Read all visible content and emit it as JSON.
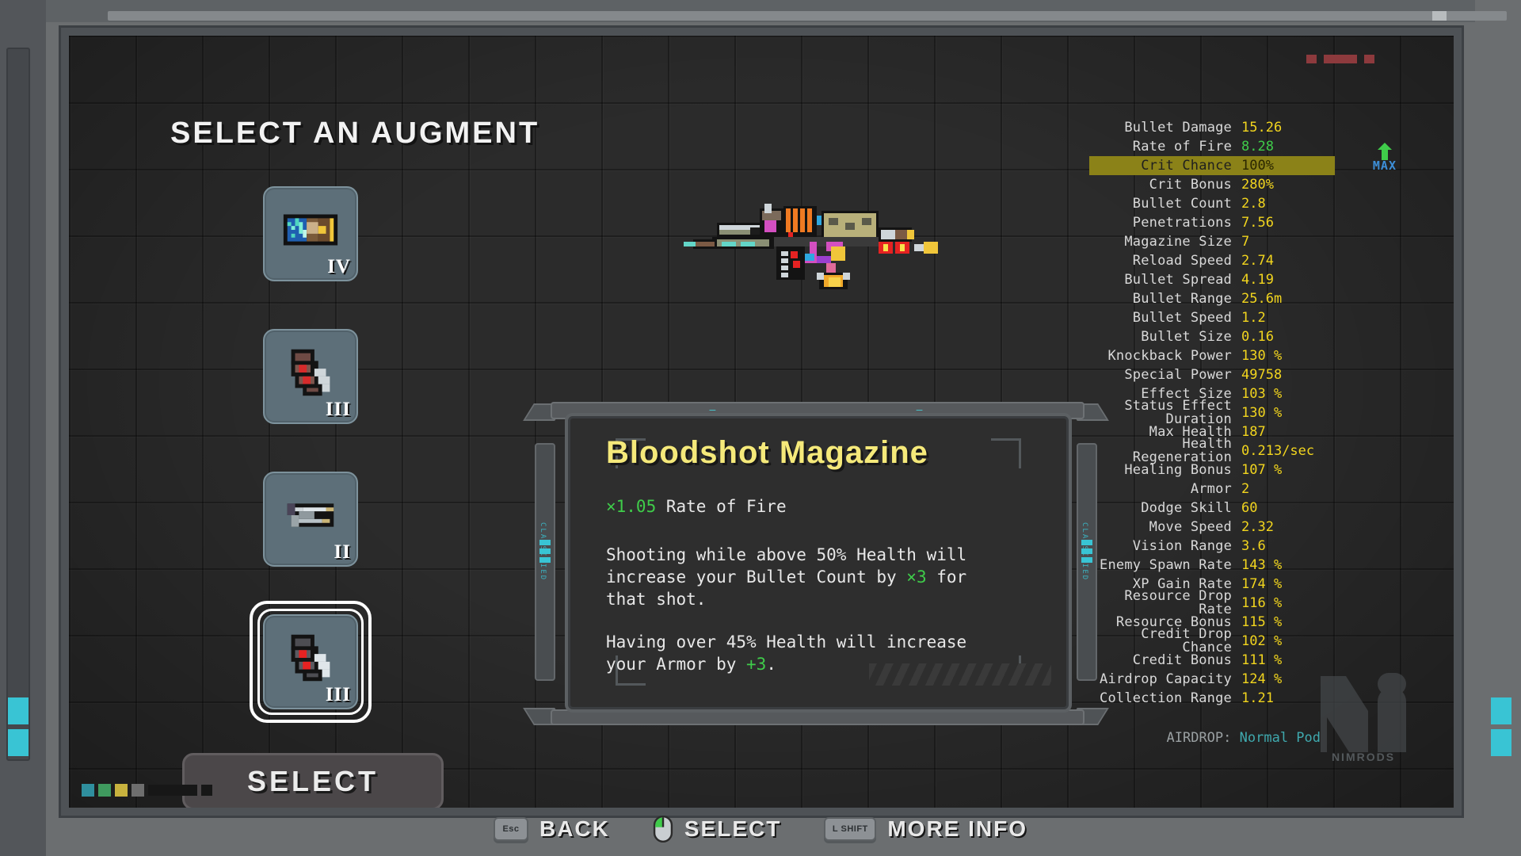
{
  "window": {
    "title_bar": ""
  },
  "heading": "SELECT AN AUGMENT",
  "select_button": {
    "label": "SELECT"
  },
  "augment_cards": [
    {
      "tier": "IV",
      "icon": "battery-magazine-icon",
      "selected": false
    },
    {
      "tier": "III",
      "icon": "bloodshot-magazine-icon",
      "selected": false
    },
    {
      "tier": "II",
      "icon": "speed-loader-icon",
      "selected": false
    },
    {
      "tier": "III",
      "icon": "bloodshot-magazine-icon",
      "selected": true
    }
  ],
  "tooltip": {
    "title": "Bloodshot Magazine",
    "stat_line": {
      "multiplier": "×1.05",
      "stat": "Rate of Fire"
    },
    "desc_1_a": "Shooting while above 50% Health will increase your Bullet Count by ",
    "desc_1_b": "×3",
    "desc_1_c": " for that shot.",
    "desc_2_a": "Having over 45% Health will increase your Armor by ",
    "desc_2_b": "+3",
    "desc_2_c": ".",
    "side_label_left": "CLASSIFIED",
    "side_label_right": "CLASSIFIED",
    "runes": "— ⑁ ⑃ ⑅ ⑂ ⑊ ⑆ ⑄ ⑇ ⑈ ⑉ ⑀ ⑋ ⑁ ⑄ ⑇ —"
  },
  "stats": {
    "rows": [
      {
        "label": "Bullet Damage",
        "value": "15.26",
        "style": "normal"
      },
      {
        "label": "Rate of Fire",
        "value": "8.28",
        "style": "green"
      },
      {
        "label": "Crit Chance",
        "value": "100%",
        "style": "highlight",
        "badge": "MAX",
        "arrow": true
      },
      {
        "label": "Crit Bonus",
        "value": "280%",
        "style": "normal"
      },
      {
        "label": "Bullet Count",
        "value": "2.8",
        "style": "normal"
      },
      {
        "label": "Penetrations",
        "value": "7.56",
        "style": "normal"
      },
      {
        "label": "Magazine Size",
        "value": "7",
        "style": "normal"
      },
      {
        "label": "Reload Speed",
        "value": "2.74",
        "style": "normal"
      },
      {
        "label": "Bullet Spread",
        "value": "4.19",
        "style": "normal"
      },
      {
        "label": "Bullet Range",
        "value": "25.6m",
        "style": "normal"
      },
      {
        "label": "Bullet Speed",
        "value": "1.2",
        "style": "normal"
      },
      {
        "label": "Bullet Size",
        "value": "0.16",
        "style": "normal"
      },
      {
        "label": "Knockback Power",
        "value": "130 %",
        "style": "normal"
      },
      {
        "label": "Special Power",
        "value": "49758",
        "style": "normal"
      },
      {
        "label": "Effect Size",
        "value": "103 %",
        "style": "normal"
      },
      {
        "label": "Status Effect Duration",
        "value": "130 %",
        "style": "normal"
      },
      {
        "label": "Max Health",
        "value": "187",
        "style": "normal"
      },
      {
        "label": "Health Regeneration",
        "value": "0.213/sec",
        "style": "normal"
      },
      {
        "label": "Healing Bonus",
        "value": "107 %",
        "style": "normal"
      },
      {
        "label": "Armor",
        "value": "2",
        "style": "normal"
      },
      {
        "label": "Dodge Skill",
        "value": "60",
        "style": "normal"
      },
      {
        "label": "Move Speed",
        "value": "2.32",
        "style": "normal"
      },
      {
        "label": "Vision Range",
        "value": "3.6",
        "style": "normal"
      },
      {
        "label": "Enemy Spawn Rate",
        "value": "143 %",
        "style": "normal"
      },
      {
        "label": "XP Gain Rate",
        "value": "174 %",
        "style": "normal"
      },
      {
        "label": "Resource Drop Rate",
        "value": "116 %",
        "style": "normal"
      },
      {
        "label": "Resource Bonus",
        "value": "115 %",
        "style": "normal"
      },
      {
        "label": "Credit Drop Chance",
        "value": "102 %",
        "style": "normal"
      },
      {
        "label": "Credit Bonus",
        "value": "111 %",
        "style": "normal"
      },
      {
        "label": "Airdrop Capacity",
        "value": "124 %",
        "style": "normal"
      },
      {
        "label": "Collection Range",
        "value": "1.21",
        "style": "normal"
      }
    ]
  },
  "airdrop": {
    "label": "AIRDROP:",
    "value": "Normal Pod"
  },
  "logo": {
    "word": "NIMRODS"
  },
  "hotkeys": [
    {
      "key": "Esc",
      "label": "BACK",
      "icon": "esc-key-icon"
    },
    {
      "key": "",
      "label": "SELECT",
      "icon": "mouse-left-click-icon"
    },
    {
      "key": "L SHIFT",
      "label": "MORE INFO",
      "icon": "shift-key-icon"
    }
  ],
  "colors": {
    "accent_yellow": "#f2d51e",
    "accent_green": "#3fcc4a",
    "highlight_row": "#8b8218",
    "title_yellow": "#f5e97a",
    "cyan": "#39c4d4",
    "badge_blue": "#3d8fd8"
  }
}
